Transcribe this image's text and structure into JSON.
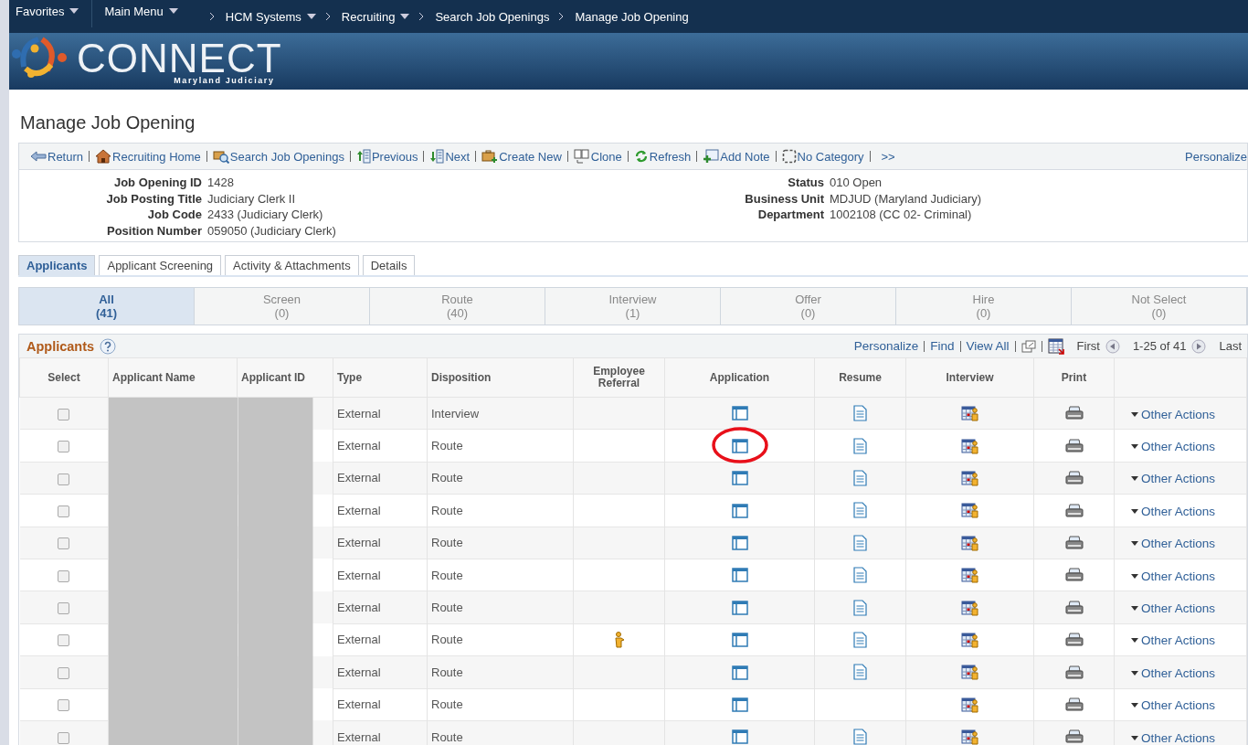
{
  "nav": {
    "items": [
      {
        "label": "Favorites",
        "kind": "menu"
      },
      {
        "label": "Main Menu",
        "kind": "menu"
      },
      {
        "label": "HCM Systems",
        "kind": "crumb-menu"
      },
      {
        "label": "Recruiting",
        "kind": "crumb-menu"
      },
      {
        "label": "Search Job Openings",
        "kind": "crumb"
      },
      {
        "label": "Manage Job Opening",
        "kind": "crumb"
      }
    ]
  },
  "banner": {
    "logo_text": "CONNECT",
    "logo_subtitle": "Maryland Judiciary"
  },
  "page_title": "Manage Job Opening",
  "toolbar": {
    "items": [
      {
        "label": "Return",
        "kind": "return"
      },
      {
        "label": "Recruiting Home",
        "kind": "home"
      },
      {
        "label": "Search Job Openings",
        "kind": "search"
      },
      {
        "label": "Previous",
        "kind": "previous"
      },
      {
        "label": "Next",
        "kind": "next"
      },
      {
        "label": "Create New",
        "kind": "create"
      },
      {
        "label": "Clone",
        "kind": "clone"
      },
      {
        "label": "Refresh",
        "kind": "refresh"
      },
      {
        "label": "Add Note",
        "kind": "note"
      },
      {
        "label": "No Category",
        "kind": "category"
      },
      {
        "label": ">>",
        "kind": "more"
      }
    ],
    "personalize": "Personalize"
  },
  "details": {
    "left": [
      {
        "label": "Job Opening ID",
        "value": "1428"
      },
      {
        "label": "Job Posting Title",
        "value": "Judiciary Clerk II"
      },
      {
        "label": "Job Code",
        "value": "2433 (Judiciary Clerk)"
      },
      {
        "label": "Position Number",
        "value": "059050 (Judiciary Clerk)"
      }
    ],
    "right": [
      {
        "label": "Status",
        "value": "010 Open"
      },
      {
        "label": "Business Unit",
        "value": "MDJUD (Maryland Judiciary)"
      },
      {
        "label": "Department",
        "value": "1002108 (CC 02- Criminal)"
      }
    ]
  },
  "tabs": [
    {
      "label": "Applicants",
      "selected": true
    },
    {
      "label": "Applicant Screening",
      "selected": false
    },
    {
      "label": "Activity & Attachments",
      "selected": false
    },
    {
      "label": "Details",
      "selected": false
    }
  ],
  "stages": [
    {
      "label": "All",
      "count": "(41)",
      "selected": true
    },
    {
      "label": "Screen",
      "count": "(0)",
      "selected": false
    },
    {
      "label": "Route",
      "count": "(40)",
      "selected": false
    },
    {
      "label": "Interview",
      "count": "(1)",
      "selected": false
    },
    {
      "label": "Offer",
      "count": "(0)",
      "selected": false
    },
    {
      "label": "Hire",
      "count": "(0)",
      "selected": false
    },
    {
      "label": "Not Select",
      "count": "(0)",
      "selected": false
    }
  ],
  "grid": {
    "title": "Applicants",
    "links": [
      "Personalize",
      "Find",
      "View All"
    ],
    "first": "First",
    "range": "1-25 of 41",
    "last": "Last",
    "columns": [
      "Select",
      "Applicant Name",
      "Applicant ID",
      "Type",
      "Disposition",
      "Employee Referral",
      "Application",
      "Resume",
      "Interview",
      "Print"
    ],
    "rows": [
      {
        "checked": false,
        "type": "External",
        "disposition": "Interview",
        "referral": false,
        "resume": true,
        "circled": false,
        "action": "Other Actions"
      },
      {
        "checked": false,
        "type": "External",
        "disposition": "Route",
        "referral": false,
        "resume": true,
        "circled": true,
        "action": "Other Actions"
      },
      {
        "checked": false,
        "type": "External",
        "disposition": "Route",
        "referral": false,
        "resume": true,
        "circled": false,
        "action": "Other Actions"
      },
      {
        "checked": false,
        "type": "External",
        "disposition": "Route",
        "referral": false,
        "resume": true,
        "circled": false,
        "action": "Other Actions"
      },
      {
        "checked": false,
        "type": "External",
        "disposition": "Route",
        "referral": false,
        "resume": true,
        "circled": false,
        "action": "Other Actions"
      },
      {
        "checked": false,
        "type": "External",
        "disposition": "Route",
        "referral": false,
        "resume": true,
        "circled": false,
        "action": "Other Actions"
      },
      {
        "checked": false,
        "type": "External",
        "disposition": "Route",
        "referral": false,
        "resume": true,
        "circled": false,
        "action": "Other Actions"
      },
      {
        "checked": false,
        "type": "External",
        "disposition": "Route",
        "referral": true,
        "resume": true,
        "circled": false,
        "action": "Other Actions"
      },
      {
        "checked": false,
        "type": "External",
        "disposition": "Route",
        "referral": false,
        "resume": true,
        "circled": false,
        "action": "Other Actions"
      },
      {
        "checked": false,
        "type": "External",
        "disposition": "Route",
        "referral": false,
        "resume": false,
        "circled": false,
        "action": "Other Actions"
      },
      {
        "checked": false,
        "type": "External",
        "disposition": "Route",
        "referral": false,
        "resume": true,
        "circled": false,
        "action": "Other Actions"
      }
    ]
  }
}
